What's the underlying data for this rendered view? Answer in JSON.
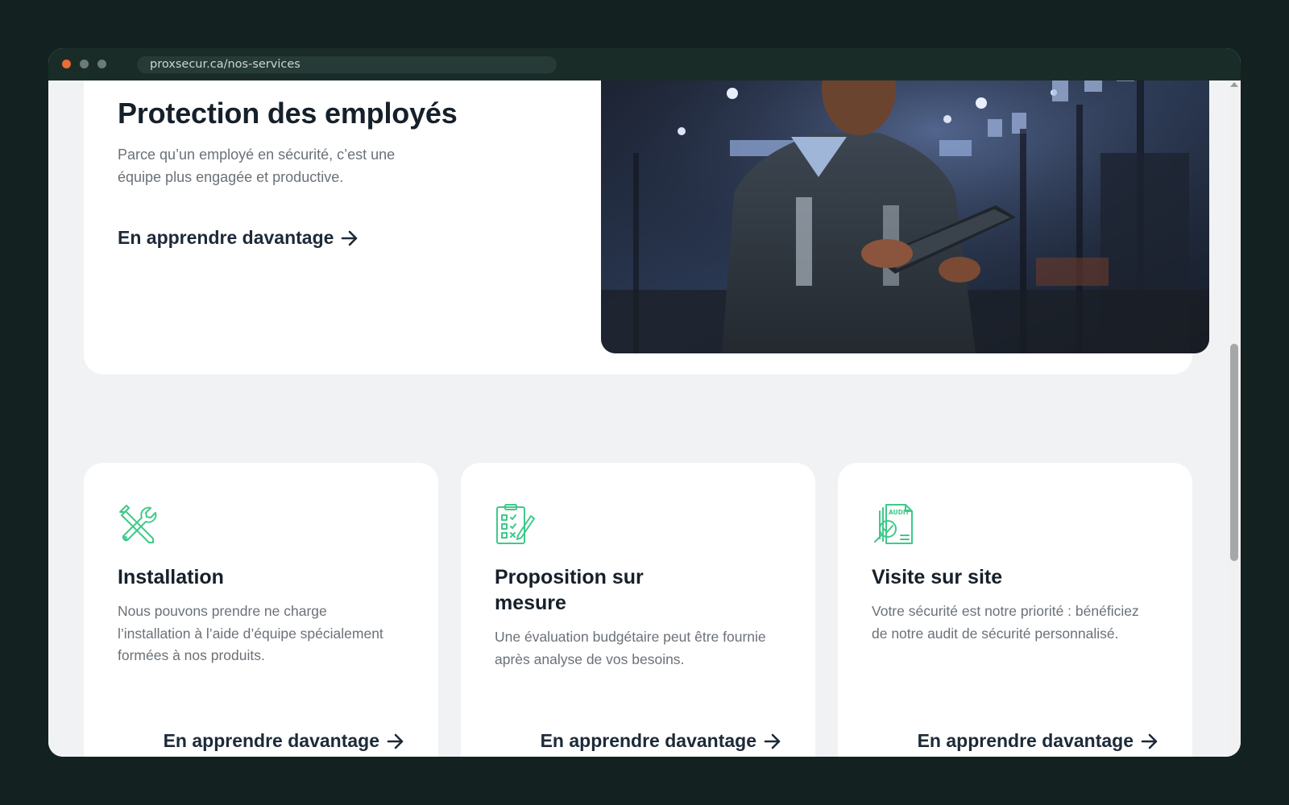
{
  "browser": {
    "url": "proxsecur.ca/nos-services"
  },
  "hero": {
    "title": "Protection des employés",
    "description": "Parce qu’un employé en sécurité, c’est une équipe plus engagée et productive.",
    "link_label": "En apprendre davantage"
  },
  "cards": [
    {
      "icon": "tools-icon",
      "title": "Installation",
      "description": "Nous pouvons prendre ne charge l’installation à l’aide d’équipe spécialement formées à nos produits.",
      "link_label": "En apprendre davantage"
    },
    {
      "icon": "checklist-clipboard-icon",
      "title": "Proposition sur mesure",
      "description": "Une évaluation budgétaire peut être fournie après analyse de vos besoins.",
      "link_label": "En apprendre davantage"
    },
    {
      "icon": "audit-document-icon",
      "title": "Visite sur site",
      "description": "Votre sécurité est notre priorité : bénéficiez de notre audit de sécurité personnalisé.",
      "link_label": "En apprendre davantage",
      "icon_badge": "AUDIT"
    }
  ],
  "colors": {
    "accent_green": "#3fc98a",
    "heading": "#16202a",
    "body_text": "#6b7178",
    "page_bg": "#f0f2f4"
  }
}
